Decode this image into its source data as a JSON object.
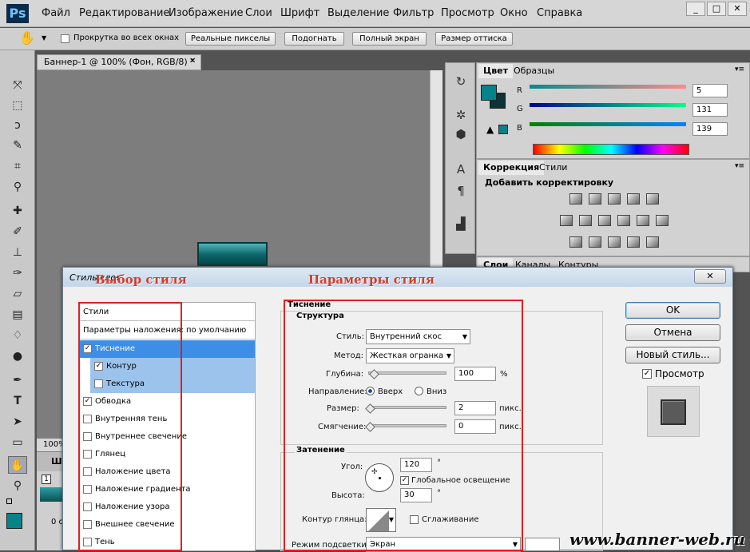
{
  "app": {
    "logo": "Ps"
  },
  "menu": [
    "Файл",
    "Редактирование",
    "Изображение",
    "Слои",
    "Шрифт",
    "Выделение",
    "Фильтр",
    "Просмотр",
    "Окно",
    "Справка"
  ],
  "options": {
    "scroll_all": "Прокрутка во всех окнах",
    "actual_pixels": "Реальные пикселы",
    "fit": "Подогнать",
    "full_screen": "Полный экран",
    "print_size": "Размер оттиска"
  },
  "document": {
    "tab": "Баннер-1 @ 100% (Фон, RGB/8) *",
    "zoom": "100%",
    "layers_tab": "Ш"
  },
  "color_panel": {
    "tab_color": "Цвет",
    "tab_swatches": "Образцы",
    "r_label": "R",
    "g_label": "G",
    "b_label": "B",
    "r": "5",
    "g": "131",
    "b": "139",
    "fg_color": "#05838b",
    "bg_color": "#0a3438"
  },
  "corrections_panel": {
    "tab_corr": "Коррекция",
    "tab_styles": "Стили",
    "title": "Добавить корректировку"
  },
  "layers_panel": {
    "tabs": [
      "Слои",
      "Каналы",
      "Контуры"
    ]
  },
  "dialog": {
    "title": "Стиль слоя",
    "annotation_left": "Выбор стиля",
    "annotation_right": "Параметры стиля",
    "styles_header": "Стили",
    "blend_options": "Параметры наложения: по умолчанию",
    "style_list": [
      {
        "label": "Тиснение",
        "checked": true,
        "selected": true,
        "sub": false
      },
      {
        "label": "Контур",
        "checked": true,
        "selected": false,
        "sub": true
      },
      {
        "label": "Текстура",
        "checked": false,
        "selected": false,
        "sub": true
      },
      {
        "label": "Обводка",
        "checked": true,
        "selected": false,
        "sub": false
      },
      {
        "label": "Внутренняя тень",
        "checked": false,
        "selected": false,
        "sub": false
      },
      {
        "label": "Внутреннее свечение",
        "checked": false,
        "selected": false,
        "sub": false
      },
      {
        "label": "Глянец",
        "checked": false,
        "selected": false,
        "sub": false
      },
      {
        "label": "Наложение цвета",
        "checked": false,
        "selected": false,
        "sub": false
      },
      {
        "label": "Наложение градиента",
        "checked": false,
        "selected": false,
        "sub": false
      },
      {
        "label": "Наложение узора",
        "checked": false,
        "selected": false,
        "sub": false
      },
      {
        "label": "Внешнее свечение",
        "checked": false,
        "selected": false,
        "sub": false
      },
      {
        "label": "Тень",
        "checked": false,
        "selected": false,
        "sub": false
      }
    ],
    "section_emboss": "Тиснение",
    "section_structure": "Структура",
    "style_label": "Стиль:",
    "style_value": "Внутренний скос",
    "method_label": "Метод:",
    "method_value": "Жесткая огранка",
    "depth_label": "Глубина:",
    "depth_value": "100",
    "depth_unit": "%",
    "depth_level": 0.05,
    "direction_label": "Направление:",
    "dir_up": "Вверх",
    "dir_down": "Вниз",
    "size_label": "Размер:",
    "size_value": "2",
    "size_unit": "пикс.",
    "soften_label": "Смягчение:",
    "soften_value": "0",
    "soften_unit": "пикс.",
    "section_shading": "Затенение",
    "angle_label": "Угол:",
    "angle_value": "120",
    "angle_unit": "°",
    "global_light": "Глобальное освещение",
    "altitude_label": "Высота:",
    "altitude_value": "30",
    "altitude_unit": "°",
    "gloss_label": "Контур глянца:",
    "antialias": "Сглаживание",
    "highlight_label": "Режим подсветки:",
    "highlight_value": "Экран",
    "ok": "OK",
    "cancel": "Отмена",
    "new_style": "Новый стиль...",
    "preview": "Просмотр"
  },
  "watermark": "www.banner-web.ru"
}
